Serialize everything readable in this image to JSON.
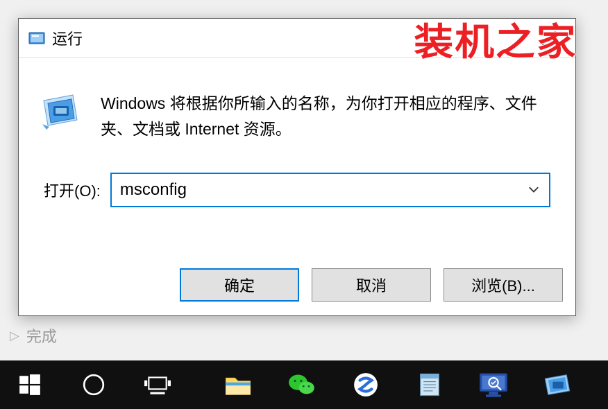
{
  "dialog": {
    "title": "运行",
    "description": "Windows 将根据你所输入的名称，为你打开相应的程序、文件夹、文档或 Internet 资源。",
    "open_label": "打开(O):",
    "input_value": "msconfig",
    "buttons": {
      "ok": "确定",
      "cancel": "取消",
      "browse": "浏览(B)..."
    }
  },
  "watermark": "装机之家",
  "under_text": "完成",
  "taskbar": {
    "items": [
      "start",
      "cortana",
      "taskview",
      "explorer",
      "wechat",
      "sogou",
      "notepad",
      "monitor",
      "run"
    ]
  }
}
